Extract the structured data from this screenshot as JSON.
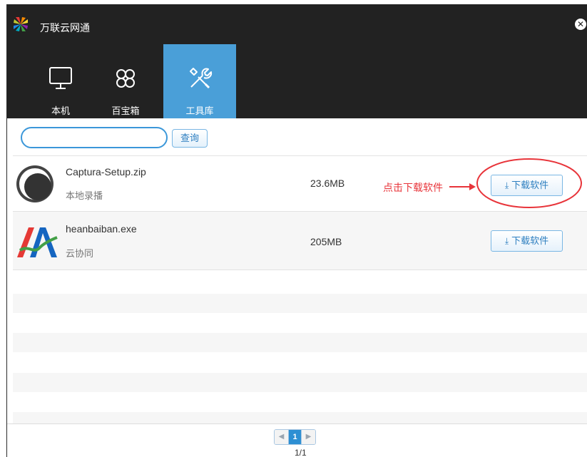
{
  "app": {
    "title": "万联云网通",
    "close_glyph": "✕",
    "logo_icon": "pinwheel-logo-icon"
  },
  "tabs": [
    {
      "label": "本机",
      "icon": "monitor-icon",
      "active": false
    },
    {
      "label": "百宝箱",
      "icon": "clover-icon",
      "active": false
    },
    {
      "label": "工具库",
      "icon": "tools-icon",
      "active": true
    }
  ],
  "search": {
    "value": "",
    "placeholder": "",
    "button_label": "查询"
  },
  "files": [
    {
      "name": "Captura-Setup.zip",
      "desc": "本地录播",
      "size": "23.6MB",
      "download_label": "下载软件",
      "icon": "captura-icon"
    },
    {
      "name": "heanbaiban.exe",
      "desc": "云协同",
      "size": "205MB",
      "download_label": "下载软件",
      "icon": "heanbaiban-icon"
    }
  ],
  "annotation": {
    "text": "点击下载软件",
    "color": "#e8343a"
  },
  "pagination": {
    "prev": "◀",
    "current": "1",
    "next": "▶",
    "summary": "1/1"
  },
  "colors": {
    "header_bg": "#222222",
    "active_tab": "#4a9fd8",
    "accent": "#2e7fc0"
  }
}
